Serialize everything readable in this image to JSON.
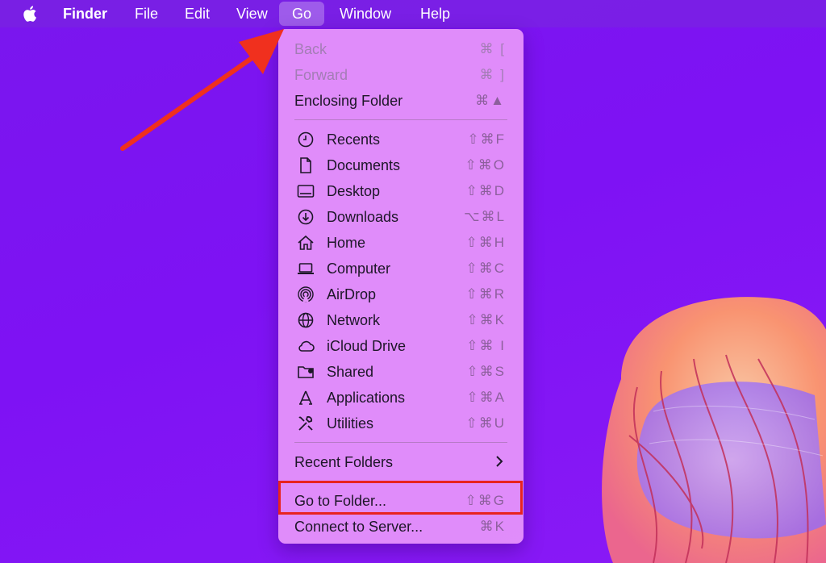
{
  "menubar": {
    "app_name": "Finder",
    "items": [
      "File",
      "Edit",
      "View",
      "Go",
      "Window",
      "Help"
    ]
  },
  "menu": {
    "back": {
      "label": "Back",
      "shortcut": "⌘ ["
    },
    "forward": {
      "label": "Forward",
      "shortcut": "⌘ ]"
    },
    "enclosing": {
      "label": "Enclosing Folder",
      "shortcut": "⌘▲"
    },
    "places": [
      {
        "label": "Recents",
        "shortcut": "⇧⌘F",
        "icon": "clock-icon"
      },
      {
        "label": "Documents",
        "shortcut": "⇧⌘O",
        "icon": "document-icon"
      },
      {
        "label": "Desktop",
        "shortcut": "⇧⌘D",
        "icon": "desktop-icon"
      },
      {
        "label": "Downloads",
        "shortcut": "⌥⌘L",
        "icon": "download-icon"
      },
      {
        "label": "Home",
        "shortcut": "⇧⌘H",
        "icon": "home-icon"
      },
      {
        "label": "Computer",
        "shortcut": "⇧⌘C",
        "icon": "laptop-icon"
      },
      {
        "label": "AirDrop",
        "shortcut": "⇧⌘R",
        "icon": "airdrop-icon"
      },
      {
        "label": "Network",
        "shortcut": "⇧⌘K",
        "icon": "globe-icon"
      },
      {
        "label": "iCloud Drive",
        "shortcut": "⇧⌘ I",
        "icon": "cloud-icon"
      },
      {
        "label": "Shared",
        "shortcut": "⇧⌘S",
        "icon": "shared-folder-icon"
      },
      {
        "label": "Applications",
        "shortcut": "⇧⌘A",
        "icon": "applications-icon"
      },
      {
        "label": "Utilities",
        "shortcut": "⇧⌘U",
        "icon": "utilities-icon"
      }
    ],
    "recent_folders": {
      "label": "Recent Folders",
      "icon": "chevron-right-icon"
    },
    "go_to_folder": {
      "label": "Go to Folder...",
      "shortcut": "⇧⌘G"
    },
    "connect": {
      "label": "Connect to Server...",
      "shortcut": "⌘K"
    }
  },
  "colors": {
    "background": "#7e12f4",
    "menu_background": "#e492fa",
    "highlight_border": "#e8231f",
    "arrow": "#f0301e"
  }
}
